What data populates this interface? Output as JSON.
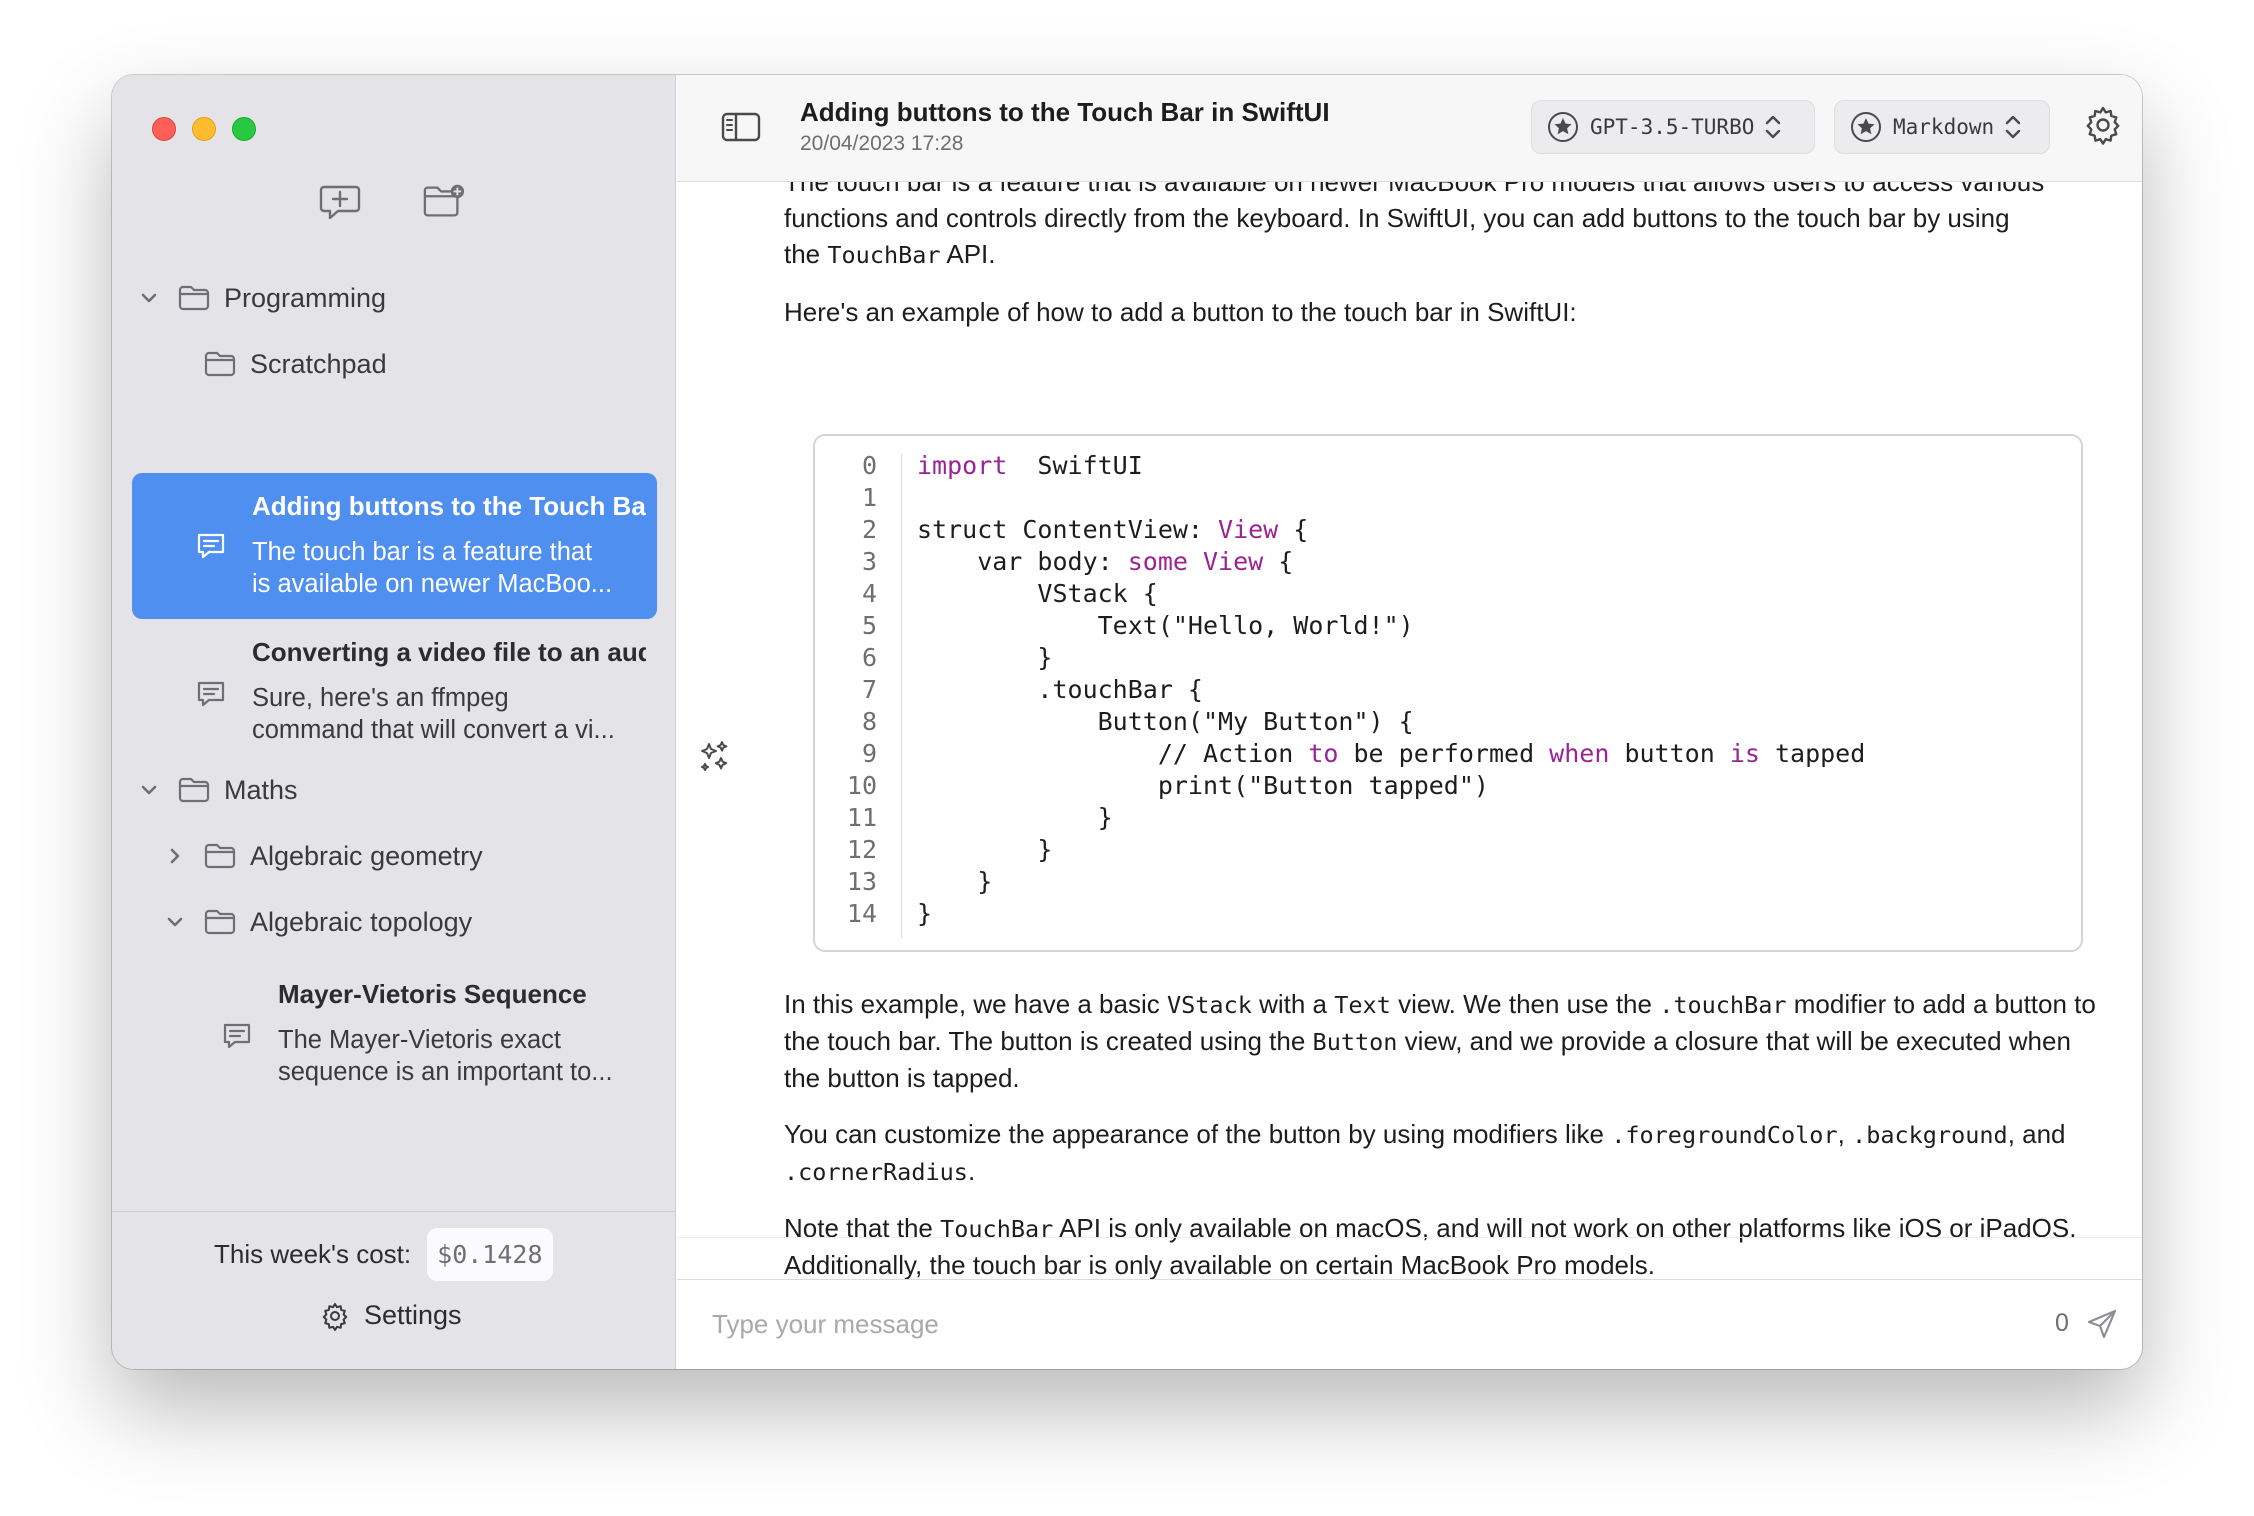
{
  "sidebar": {
    "tree": [
      {
        "type": "folder",
        "label": "Programming",
        "expanded": true,
        "level": 0
      },
      {
        "type": "folder",
        "label": "Scratchpad",
        "expanded": null,
        "level": 1
      },
      {
        "type": "chat",
        "title": "Adding buttons to the Touch Bar in SwiftUI",
        "snippet_1": "The touch bar is a feature that",
        "snippet_2": "is available on newer MacBoo...",
        "selected": true
      },
      {
        "type": "chat",
        "title": "Converting a video file to an audio file",
        "snippet_1": "Sure, here's an ffmpeg",
        "snippet_2": "command that will convert a vi...",
        "selected": false
      },
      {
        "type": "folder",
        "label": "Maths",
        "expanded": true,
        "level": 0
      },
      {
        "type": "folder",
        "label": "Algebraic geometry",
        "expanded": false,
        "level": 1
      },
      {
        "type": "folder",
        "label": "Algebraic topology",
        "expanded": true,
        "level": 1
      },
      {
        "type": "chat",
        "title": "Mayer-Vietoris Sequence",
        "snippet_1": "The Mayer-Vietoris exact",
        "snippet_2": "sequence is an important to...",
        "selected": false
      }
    ],
    "cost_label": "This week's cost:",
    "cost_value": "$0.1428",
    "settings_label": "Settings"
  },
  "toolbar": {
    "title": "Adding buttons to the Touch Bar in SwiftUI",
    "date": "20/04/2023 17:28",
    "model": "GPT-3.5-TURBO",
    "format": "Markdown"
  },
  "message": {
    "intro_cut": "The touch bar is a feature that is available on newer MacBook Pro models that allows users to access various",
    "intro_line2": "functions and controls directly from the keyboard. In SwiftUI, you can add buttons to the touch bar by using",
    "intro_line3_a": "the ",
    "intro_line3_code": "TouchBar",
    "intro_line3_b": " API.",
    "example_lead": "Here's an example of how to add a button to the touch bar in SwiftUI:",
    "code": [
      {
        "n": "0",
        "parts": [
          [
            "kw",
            "import"
          ],
          [
            "",
            "  SwiftUI"
          ]
        ]
      },
      {
        "n": "1",
        "parts": []
      },
      {
        "n": "2",
        "parts": [
          [
            "",
            "struct ContentView: "
          ],
          [
            "kw",
            "View"
          ],
          [
            "",
            " {"
          ]
        ]
      },
      {
        "n": "3",
        "parts": [
          [
            "",
            "    var body: "
          ],
          [
            "kw",
            "some View"
          ],
          [
            "",
            " {"
          ]
        ]
      },
      {
        "n": "4",
        "parts": [
          [
            "",
            "        VStack {"
          ]
        ]
      },
      {
        "n": "5",
        "parts": [
          [
            "",
            "            Text(\"Hello, World!\")"
          ]
        ]
      },
      {
        "n": "6",
        "parts": [
          [
            "",
            "        }"
          ]
        ]
      },
      {
        "n": "7",
        "parts": [
          [
            "",
            "        .touchBar {"
          ]
        ]
      },
      {
        "n": "8",
        "parts": [
          [
            "",
            "            Button(\"My Button\") {"
          ]
        ]
      },
      {
        "n": "9",
        "parts": [
          [
            "",
            "                // Action "
          ],
          [
            "kw",
            "to"
          ],
          [
            "",
            " be performed "
          ],
          [
            "kw",
            "when"
          ],
          [
            "",
            " button "
          ],
          [
            "kw",
            "is"
          ],
          [
            "",
            " tapped"
          ]
        ]
      },
      {
        "n": "10",
        "parts": [
          [
            "",
            "                print(\"Button tapped\")"
          ]
        ]
      },
      {
        "n": "11",
        "parts": [
          [
            "",
            "            }"
          ]
        ]
      },
      {
        "n": "12",
        "parts": [
          [
            "",
            "        }"
          ]
        ]
      },
      {
        "n": "13",
        "parts": [
          [
            "",
            "    }"
          ]
        ]
      },
      {
        "n": "14",
        "parts": [
          [
            "",
            "}"
          ]
        ]
      }
    ],
    "p1_a": "In this example, we have a basic ",
    "p1_code1": "VStack",
    "p1_b": " with a ",
    "p1_code2": "Text",
    "p1_c": " view. We then use the ",
    "p1_code3": ".touchBar",
    "p1_d": " modifier to add a button to the touch bar. The button is created using the ",
    "p1_code4": "Button",
    "p1_e": " view, and we provide a closure that will be executed when the button is tapped.",
    "p2_a": "You can customize the appearance of the button by using modifiers like ",
    "p2_code1": ".foregroundColor",
    "p2_b": ", ",
    "p2_code2": ".background",
    "p2_c": ", and ",
    "p2_code3": ".cornerRadius",
    "p2_d": ".",
    "p3_a": "Note that the ",
    "p3_code1": "TouchBar",
    "p3_b": " API is only available on macOS, and will not work on other platforms like iOS or iPadOS. Additionally, the touch bar is only available on certain MacBook Pro models."
  },
  "composer": {
    "placeholder": "Type your message",
    "token_count": "0"
  },
  "icons": {
    "new_chat": "new-chat-icon",
    "new_folder": "new-folder-icon",
    "folder": "folder-icon",
    "chat": "chat-bubble-icon",
    "sidebar_toggle": "sidebar-toggle-icon",
    "model_star": "star-circle-icon",
    "gear": "gear-icon",
    "search": "magnifier-icon",
    "ai": "sparkles-icon",
    "send": "paper-plane-icon"
  },
  "colors": {
    "selection": "#4f8ff0",
    "keyword": "#9b2393",
    "traffic_red": "#ff5f57",
    "traffic_yellow": "#febc2e",
    "traffic_green": "#28c840"
  }
}
